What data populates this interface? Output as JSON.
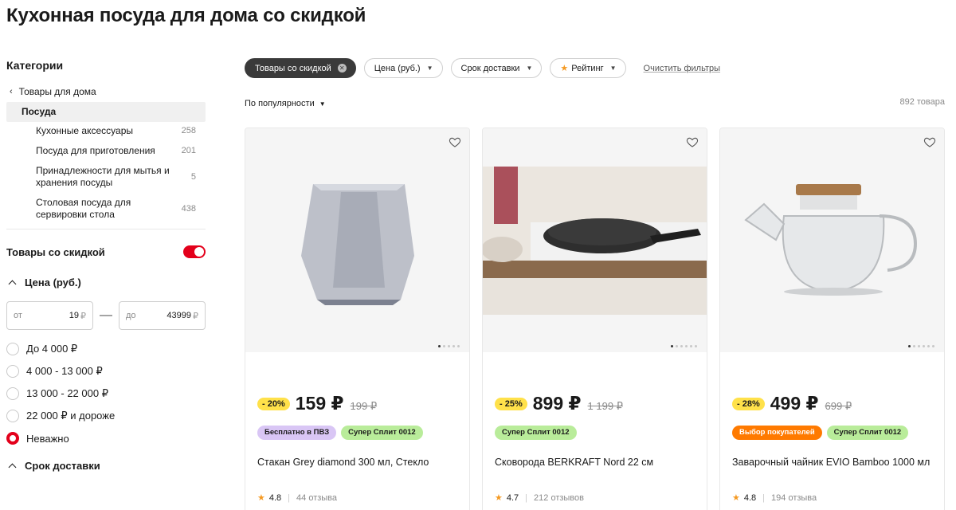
{
  "page": {
    "title": "Кухонная посуда для дома со скидкой"
  },
  "sidebar": {
    "categories_heading": "Категории",
    "breadcrumb": "Товары для дома",
    "active_category": "Посуда",
    "subcategories": [
      {
        "label": "Кухонные аксессуары",
        "count": "258"
      },
      {
        "label": "Посуда для приготовления",
        "count": "201"
      },
      {
        "label": "Принадлежности для мытья и хранения посуды",
        "count": "5"
      },
      {
        "label": "Столовая посуда для сервировки стола",
        "count": "438"
      }
    ],
    "discount_toggle": {
      "label": "Товары со скидкой",
      "on": true
    },
    "price": {
      "heading": "Цена (руб.)",
      "from_prefix": "от",
      "from_value": "19",
      "to_prefix": "до",
      "to_value": "43999",
      "currency": "₽",
      "dash": "—",
      "options": [
        "До 4 000 ₽",
        "4 000 - 13 000 ₽",
        "13 000 - 22 000 ₽",
        "22 000 ₽ и дороже",
        "Неважно"
      ],
      "selected": "Неважно"
    },
    "delivery": {
      "heading": "Срок доставки"
    }
  },
  "filters": {
    "chips": [
      {
        "label": "Товары со скидкой",
        "active": true
      },
      {
        "label": "Цена (руб.)"
      },
      {
        "label": "Срок доставки"
      },
      {
        "label": "Рейтинг"
      }
    ],
    "clear": "Очистить фильтры"
  },
  "sort": {
    "label": "По популярности"
  },
  "results": {
    "count": "892 товара"
  },
  "products": [
    {
      "discount": "- 20%",
      "price": "159 ₽",
      "old_price": "199 ₽",
      "badges": [
        {
          "text": "Бесплатно в ПВЗ",
          "color": "purple"
        },
        {
          "text": "Супер Сплит 0012",
          "color": "green"
        }
      ],
      "title": "Стакан Grey diamond 300 мл, Стекло",
      "rating": "4.8",
      "reviews": "44 отзыва"
    },
    {
      "discount": "- 25%",
      "price": "899 ₽",
      "old_price": "1 199 ₽",
      "badges": [
        {
          "text": "Супер Сплит 0012",
          "color": "green"
        }
      ],
      "title": "Сковорода BERKRAFT Nord 22 см",
      "rating": "4.7",
      "reviews": "212 отзывов"
    },
    {
      "discount": "- 28%",
      "price": "499 ₽",
      "old_price": "699 ₽",
      "badges": [
        {
          "text": "Выбор покупателей",
          "color": "orange"
        },
        {
          "text": "Супер Сплит 0012",
          "color": "green"
        }
      ],
      "title": "Заварочный чайник EVIO Bamboo 1000 мл",
      "rating": "4.8",
      "reviews": "194 отзыва"
    }
  ],
  "colors": {
    "accent": "#e3001b",
    "discount": "#ffe14a",
    "star": "#f59a23"
  }
}
